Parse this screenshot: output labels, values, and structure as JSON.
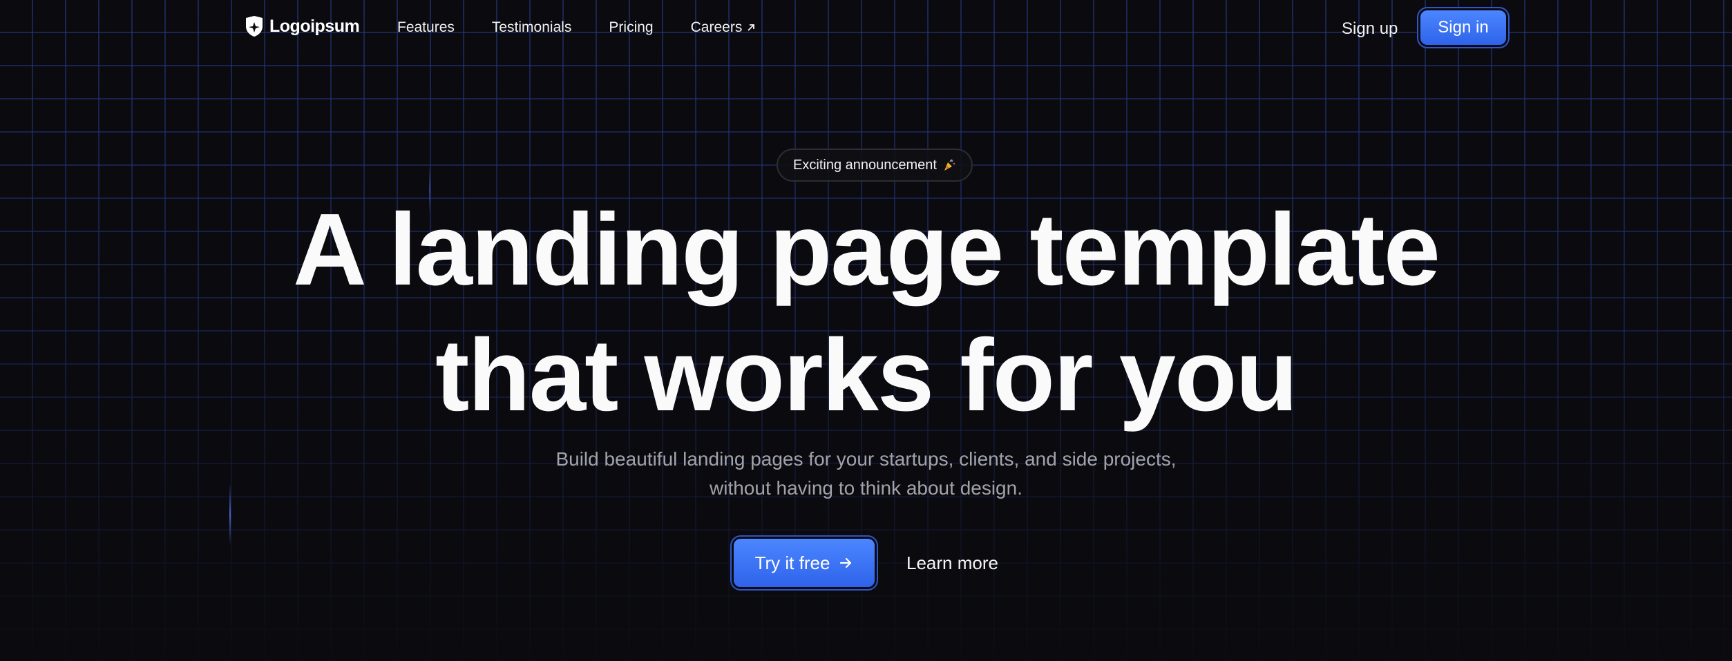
{
  "brand": {
    "name": "Logoipsum",
    "logo_icon": "shield-logo-icon"
  },
  "nav": {
    "items": [
      {
        "label": "Features"
      },
      {
        "label": "Testimonials"
      },
      {
        "label": "Pricing"
      },
      {
        "label": "Careers",
        "icon": "external-arrow-icon"
      }
    ]
  },
  "auth": {
    "signup_label": "Sign up",
    "signin_label": "Sign in"
  },
  "announcement": {
    "label": "Exciting announcement",
    "icon": "party-popper-icon"
  },
  "hero": {
    "title_line1": "A landing page template",
    "title_line2": "that works for you",
    "subtitle_line1": "Build beautiful landing pages for your startups, clients, and side projects,",
    "subtitle_line2": "without having to think about design."
  },
  "cta": {
    "primary_label": "Try it free",
    "primary_icon": "arrow-right-icon",
    "secondary_label": "Learn more"
  },
  "colors": {
    "background": "#0b0b0f",
    "accent": "#3b76f6",
    "grid": "#283c8c",
    "muted_text": "#a2a2aa"
  }
}
